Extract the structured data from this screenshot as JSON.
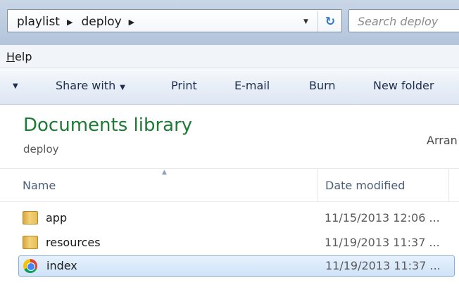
{
  "address": {
    "crumbs": [
      "playlist",
      "deploy"
    ],
    "separator": "▶",
    "dropdown": "▼",
    "refresh": "↻"
  },
  "search": {
    "placeholder": "Search deploy"
  },
  "menu": {
    "help": "Help"
  },
  "toolbar": {
    "lead_caret": "▼",
    "share_with": "Share with",
    "share_caret": "▼",
    "print": "Print",
    "email": "E-mail",
    "burn": "Burn",
    "new_folder": "New folder"
  },
  "library": {
    "title": "Documents library",
    "subtitle": "deploy",
    "arrange": "Arran"
  },
  "columns": {
    "name": "Name",
    "date": "Date modified",
    "sort_arrow": "▲"
  },
  "files": [
    {
      "name": "app",
      "date": "11/15/2013 12:06 ...",
      "icon": "folder-icon",
      "selected": false
    },
    {
      "name": "resources",
      "date": "11/19/2013 11:37 ...",
      "icon": "folder-icon",
      "selected": false
    },
    {
      "name": "index",
      "date": "11/19/2013 11:37 ...",
      "icon": "chrome-icon",
      "selected": true
    }
  ],
  "colors": {
    "library_title": "#1e7a34",
    "selection_border": "#84acdd",
    "column_header_text": "#4c607a"
  }
}
